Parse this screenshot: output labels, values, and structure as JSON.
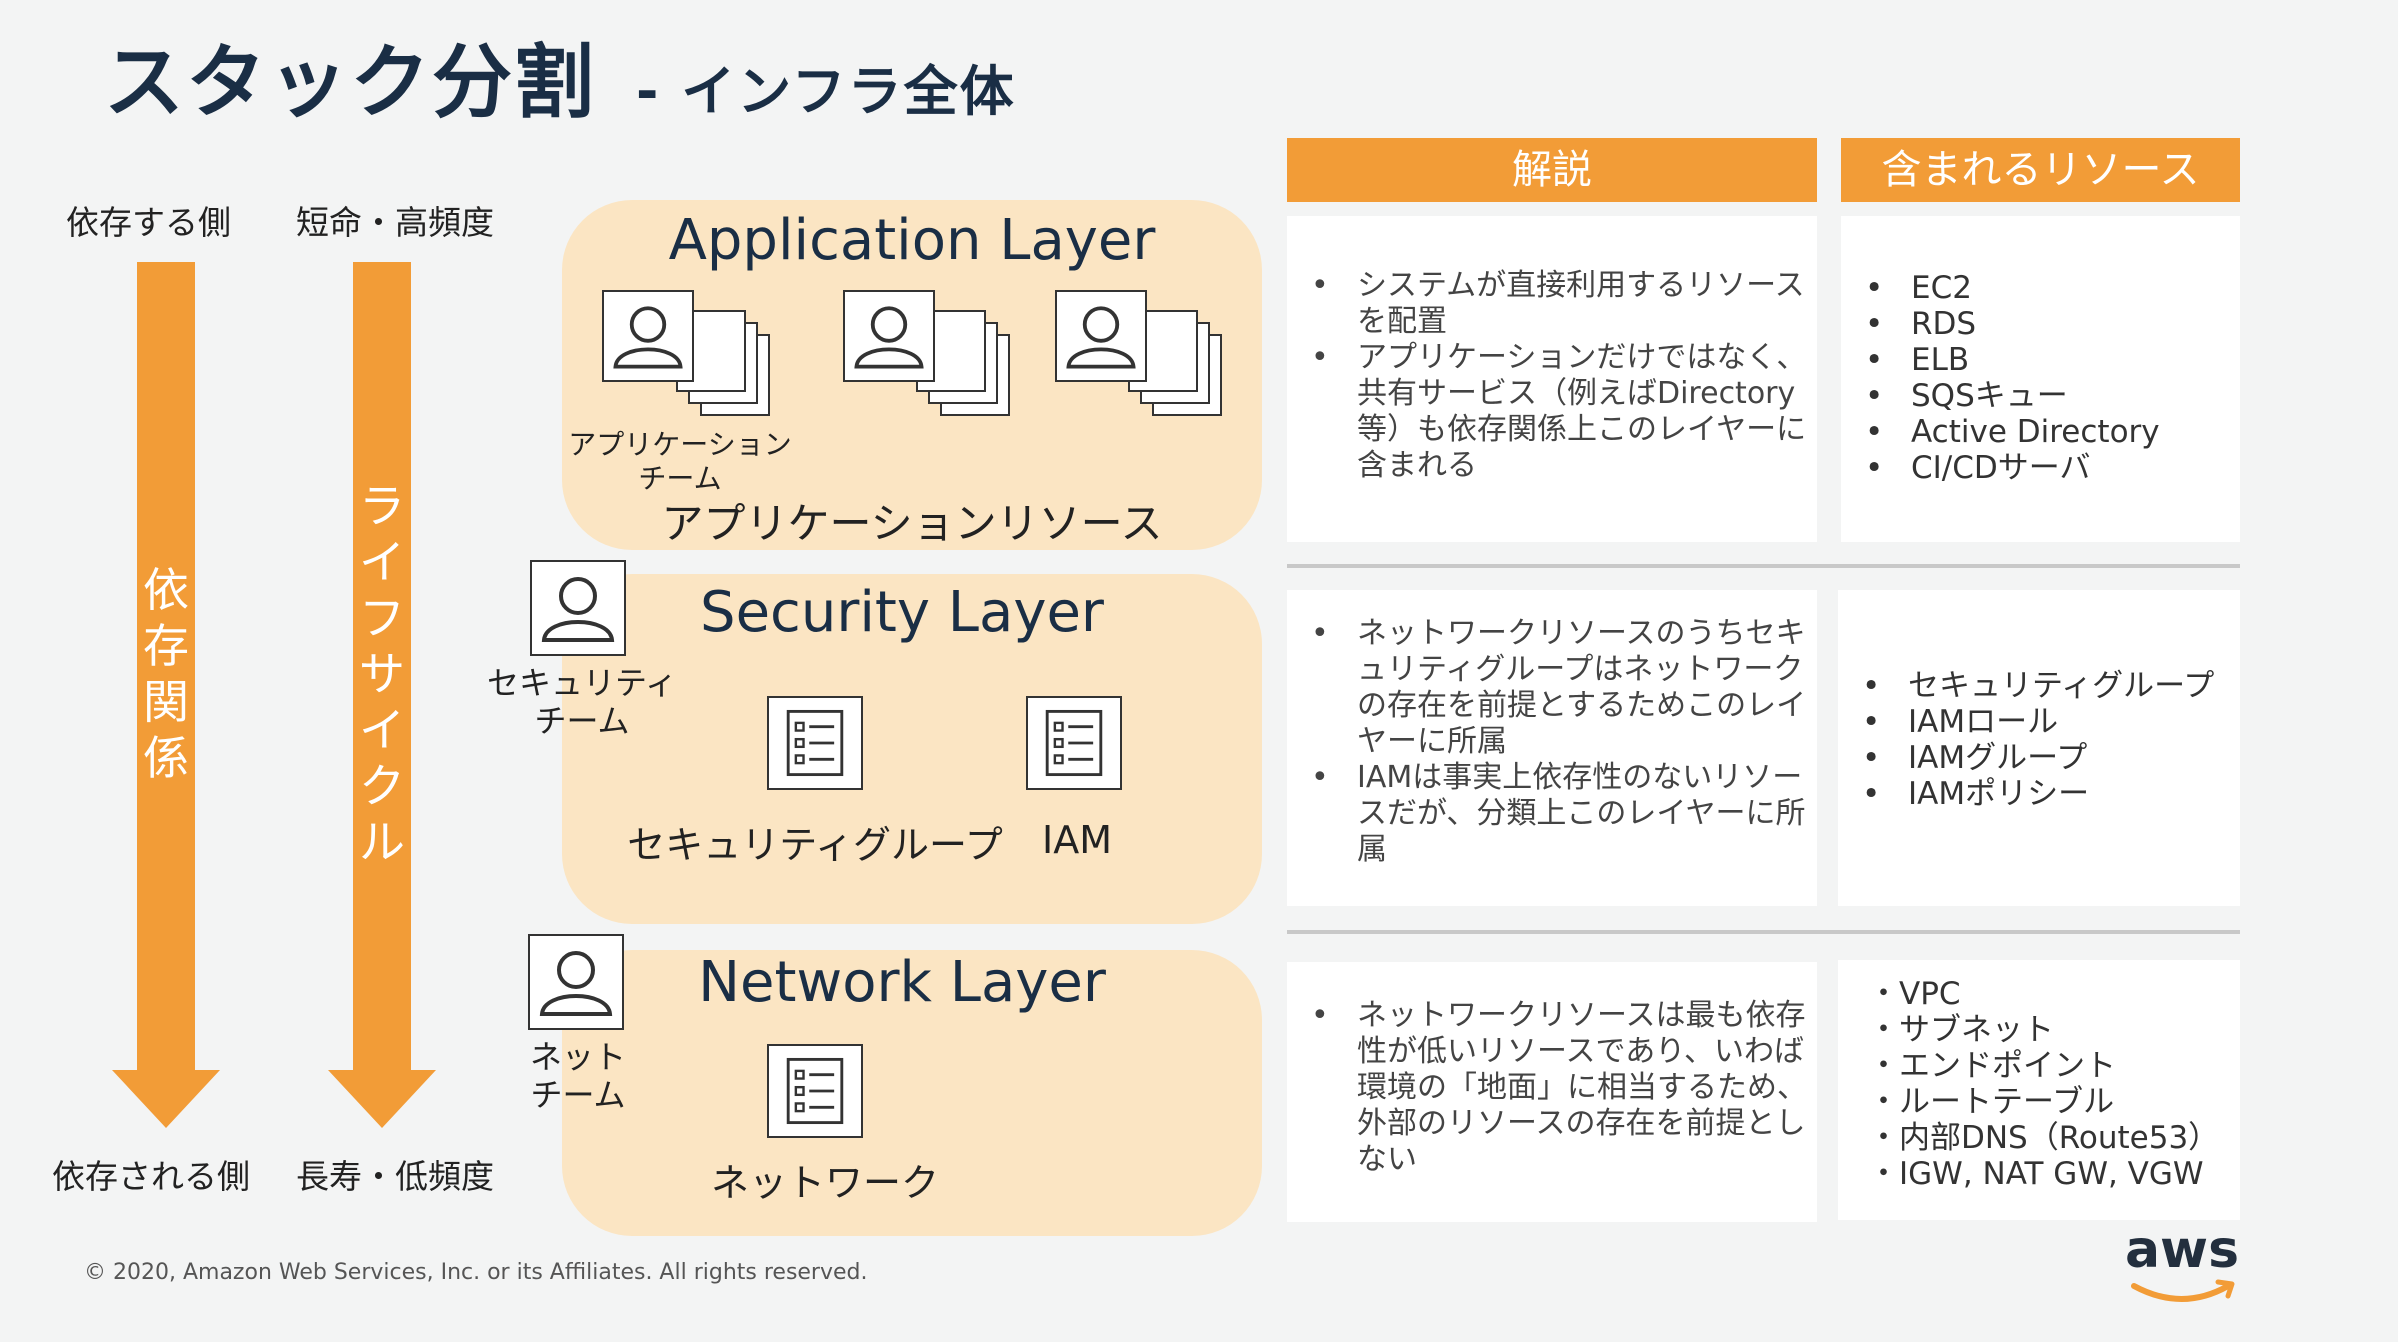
{
  "title": {
    "main": "スタック分割",
    "sub": "- インフラ全体"
  },
  "left_axis": {
    "dep_top": "依存する側",
    "dep_bottom": "依存される側",
    "dep_vertical": "依存関係",
    "life_top": "短命・高頻度",
    "life_bottom": "長寿・低頻度",
    "life_vertical": "ライフサイクル",
    "arrow_color": "#f29c37"
  },
  "layers": {
    "application": {
      "title": "Application Layer",
      "team": "アプリケーション\nチーム",
      "resource": "アプリケーションリソース"
    },
    "security": {
      "title": "Security Layer",
      "team": "セキュリティ\nチーム",
      "res1": "セキュリティグループ",
      "res2": "IAM"
    },
    "network": {
      "title": "Network Layer",
      "team": "ネット\nチーム",
      "res1": "ネットワーク"
    }
  },
  "headers": {
    "description": "解説",
    "resources": "含まれるリソース"
  },
  "rows": {
    "application": {
      "desc": [
        "システムが直接利用するリソースを配置",
        "アプリケーションだけではなく、共有サービス（例えばDirectory等）も依存関係上このレイヤーに含まれる"
      ],
      "resources": [
        "EC2",
        "RDS",
        "ELB",
        "SQSキュー",
        "Active Directory",
        "CI/CDサーバ"
      ]
    },
    "security": {
      "desc": [
        "ネットワークリソースのうちセキュリティグループはネットワークの存在を前提とするためこのレイヤーに所属",
        "IAMは事実上依存性のないリソースだが、分類上このレイヤーに所属"
      ],
      "resources": [
        "セキュリティグループ",
        "IAMロール",
        "IAMグループ",
        "IAMポリシー"
      ]
    },
    "network": {
      "desc": [
        "ネットワークリソースは最も依存性が低いリソースであり、いわば環境の「地面」に相当するため、外部のリソースの存在を前提としない"
      ],
      "resources": [
        "・VPC",
        "・サブネット",
        "・エンドポイント",
        "・ルートテーブル",
        "・内部DNS（Route53）",
        "・IGW, NAT GW, VGW"
      ]
    }
  },
  "footer": "© 2020, Amazon Web Services, Inc. or its Affiliates. All rights reserved.",
  "logo": "aws",
  "colors": {
    "accent": "#f29c37",
    "layer_bg": "#fbe5c3",
    "title": "#1a2e45"
  }
}
